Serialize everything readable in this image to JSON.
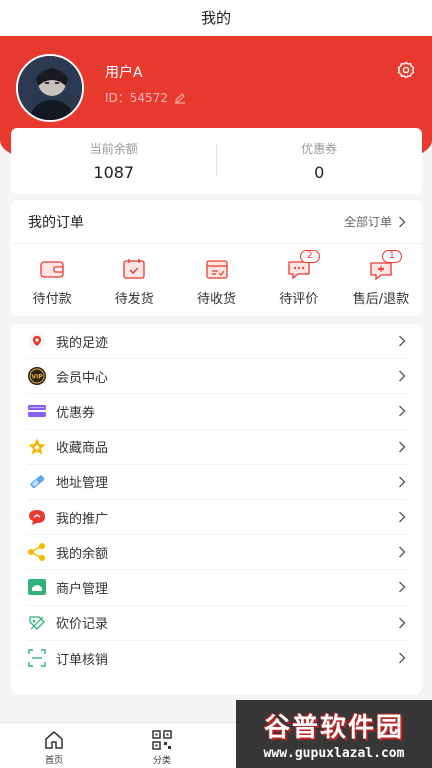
{
  "header": {
    "title": "我的"
  },
  "profile": {
    "username": "用户A",
    "id_text": "ID：54572"
  },
  "balance": {
    "items": [
      {
        "label": "当前余额",
        "value": "1087"
      },
      {
        "label": "优惠券",
        "value": "0"
      }
    ]
  },
  "orders": {
    "title": "我的订单",
    "all_label": "全部订单",
    "items": [
      {
        "label": "待付款",
        "icon": "wallet-icon",
        "badge": ""
      },
      {
        "label": "待发货",
        "icon": "calendar-check-icon",
        "badge": ""
      },
      {
        "label": "待收货",
        "icon": "package-icon",
        "badge": ""
      },
      {
        "label": "待评价",
        "icon": "chat-icon",
        "badge": "2"
      },
      {
        "label": "售后/退款",
        "icon": "aftersale-icon",
        "badge": "1"
      }
    ]
  },
  "menu": {
    "items": [
      {
        "label": "我的足迹",
        "icon": "footprint-icon"
      },
      {
        "label": "会员中心",
        "icon": "vip-icon"
      },
      {
        "label": "优惠券",
        "icon": "coupon-icon"
      },
      {
        "label": "收藏商品",
        "icon": "star-icon"
      },
      {
        "label": "地址管理",
        "icon": "address-icon"
      },
      {
        "label": "我的推广",
        "icon": "promotion-icon"
      },
      {
        "label": "我的余额",
        "icon": "share-icon"
      },
      {
        "label": "商户管理",
        "icon": "merchant-icon"
      },
      {
        "label": "砍价记录",
        "icon": "bargain-icon"
      },
      {
        "label": "订单核销",
        "icon": "scan-icon"
      }
    ]
  },
  "tabbar": {
    "items": [
      {
        "label": "首页",
        "icon": "home-icon"
      },
      {
        "label": "分类",
        "icon": "qrcode-icon"
      }
    ]
  },
  "watermark": {
    "title": "谷普软件园",
    "url": "www.gupuxlazal.com"
  },
  "colors": {
    "accent": "#e8392f"
  }
}
